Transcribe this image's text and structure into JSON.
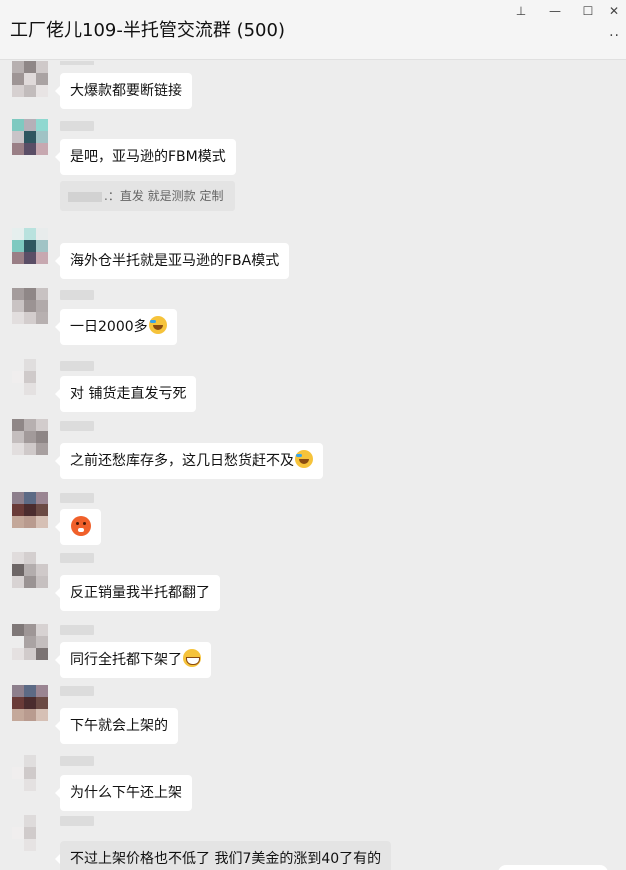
{
  "window": {
    "title": "工厂佬儿109-半托管交流群 (500)",
    "pin_glyph": "⊥",
    "minimize_glyph": "—",
    "maximize_glyph": "☐",
    "close_glyph": "✕",
    "more_glyph": "··"
  },
  "messages": [
    {
      "text": "大爆款都要断链接"
    },
    {
      "text": "是吧，亚马逊的FBM模式"
    },
    {
      "quote": ".：直发 就是测款 定制"
    },
    {
      "text": "海外仓半托就是亚马逊的FBA模式"
    },
    {
      "text": "一日2000多",
      "emoji": "laugh-cry-icon"
    },
    {
      "text": "对 铺货走直发亏死"
    },
    {
      "text": "之前还愁库存多，这几日愁货赶不及",
      "emoji": "laugh-cry-icon"
    },
    {
      "text": "",
      "emoji": "blush-icon"
    },
    {
      "text": "反正销量我半托都翻了"
    },
    {
      "text": "同行全托都下架了",
      "emoji": "grin-icon"
    },
    {
      "text": "下午就会上架的"
    },
    {
      "text": "为什么下午还上架"
    },
    {
      "text": "不过上架价格也不低了 我们7美金的涨到40了有的"
    }
  ],
  "colors": {
    "background": "#ededed",
    "bubble": "#ffffff",
    "quote": "#e4e4e4"
  }
}
